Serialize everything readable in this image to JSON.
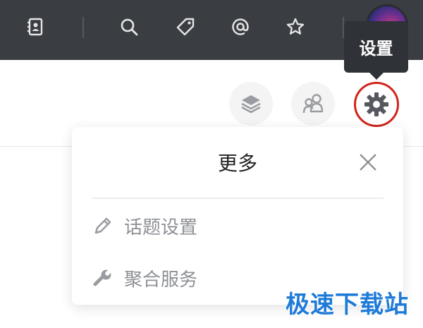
{
  "toolbar": {
    "icons": [
      "contacts-icon",
      "search-icon",
      "tag-icon",
      "at-icon",
      "star-icon"
    ]
  },
  "tooltip": {
    "text": "设置"
  },
  "popup": {
    "title": "更多",
    "items": [
      {
        "icon": "pencil-icon",
        "label": "话题设置"
      },
      {
        "icon": "wrench-icon",
        "label": "聚合服务"
      }
    ]
  },
  "watermark": {
    "text": "极速下载站"
  },
  "colors": {
    "toolbar_bg": "#3a3d42",
    "highlight_ring": "#d0251d",
    "menu_text": "#8e9096",
    "watermark": "#1e7bd8"
  }
}
